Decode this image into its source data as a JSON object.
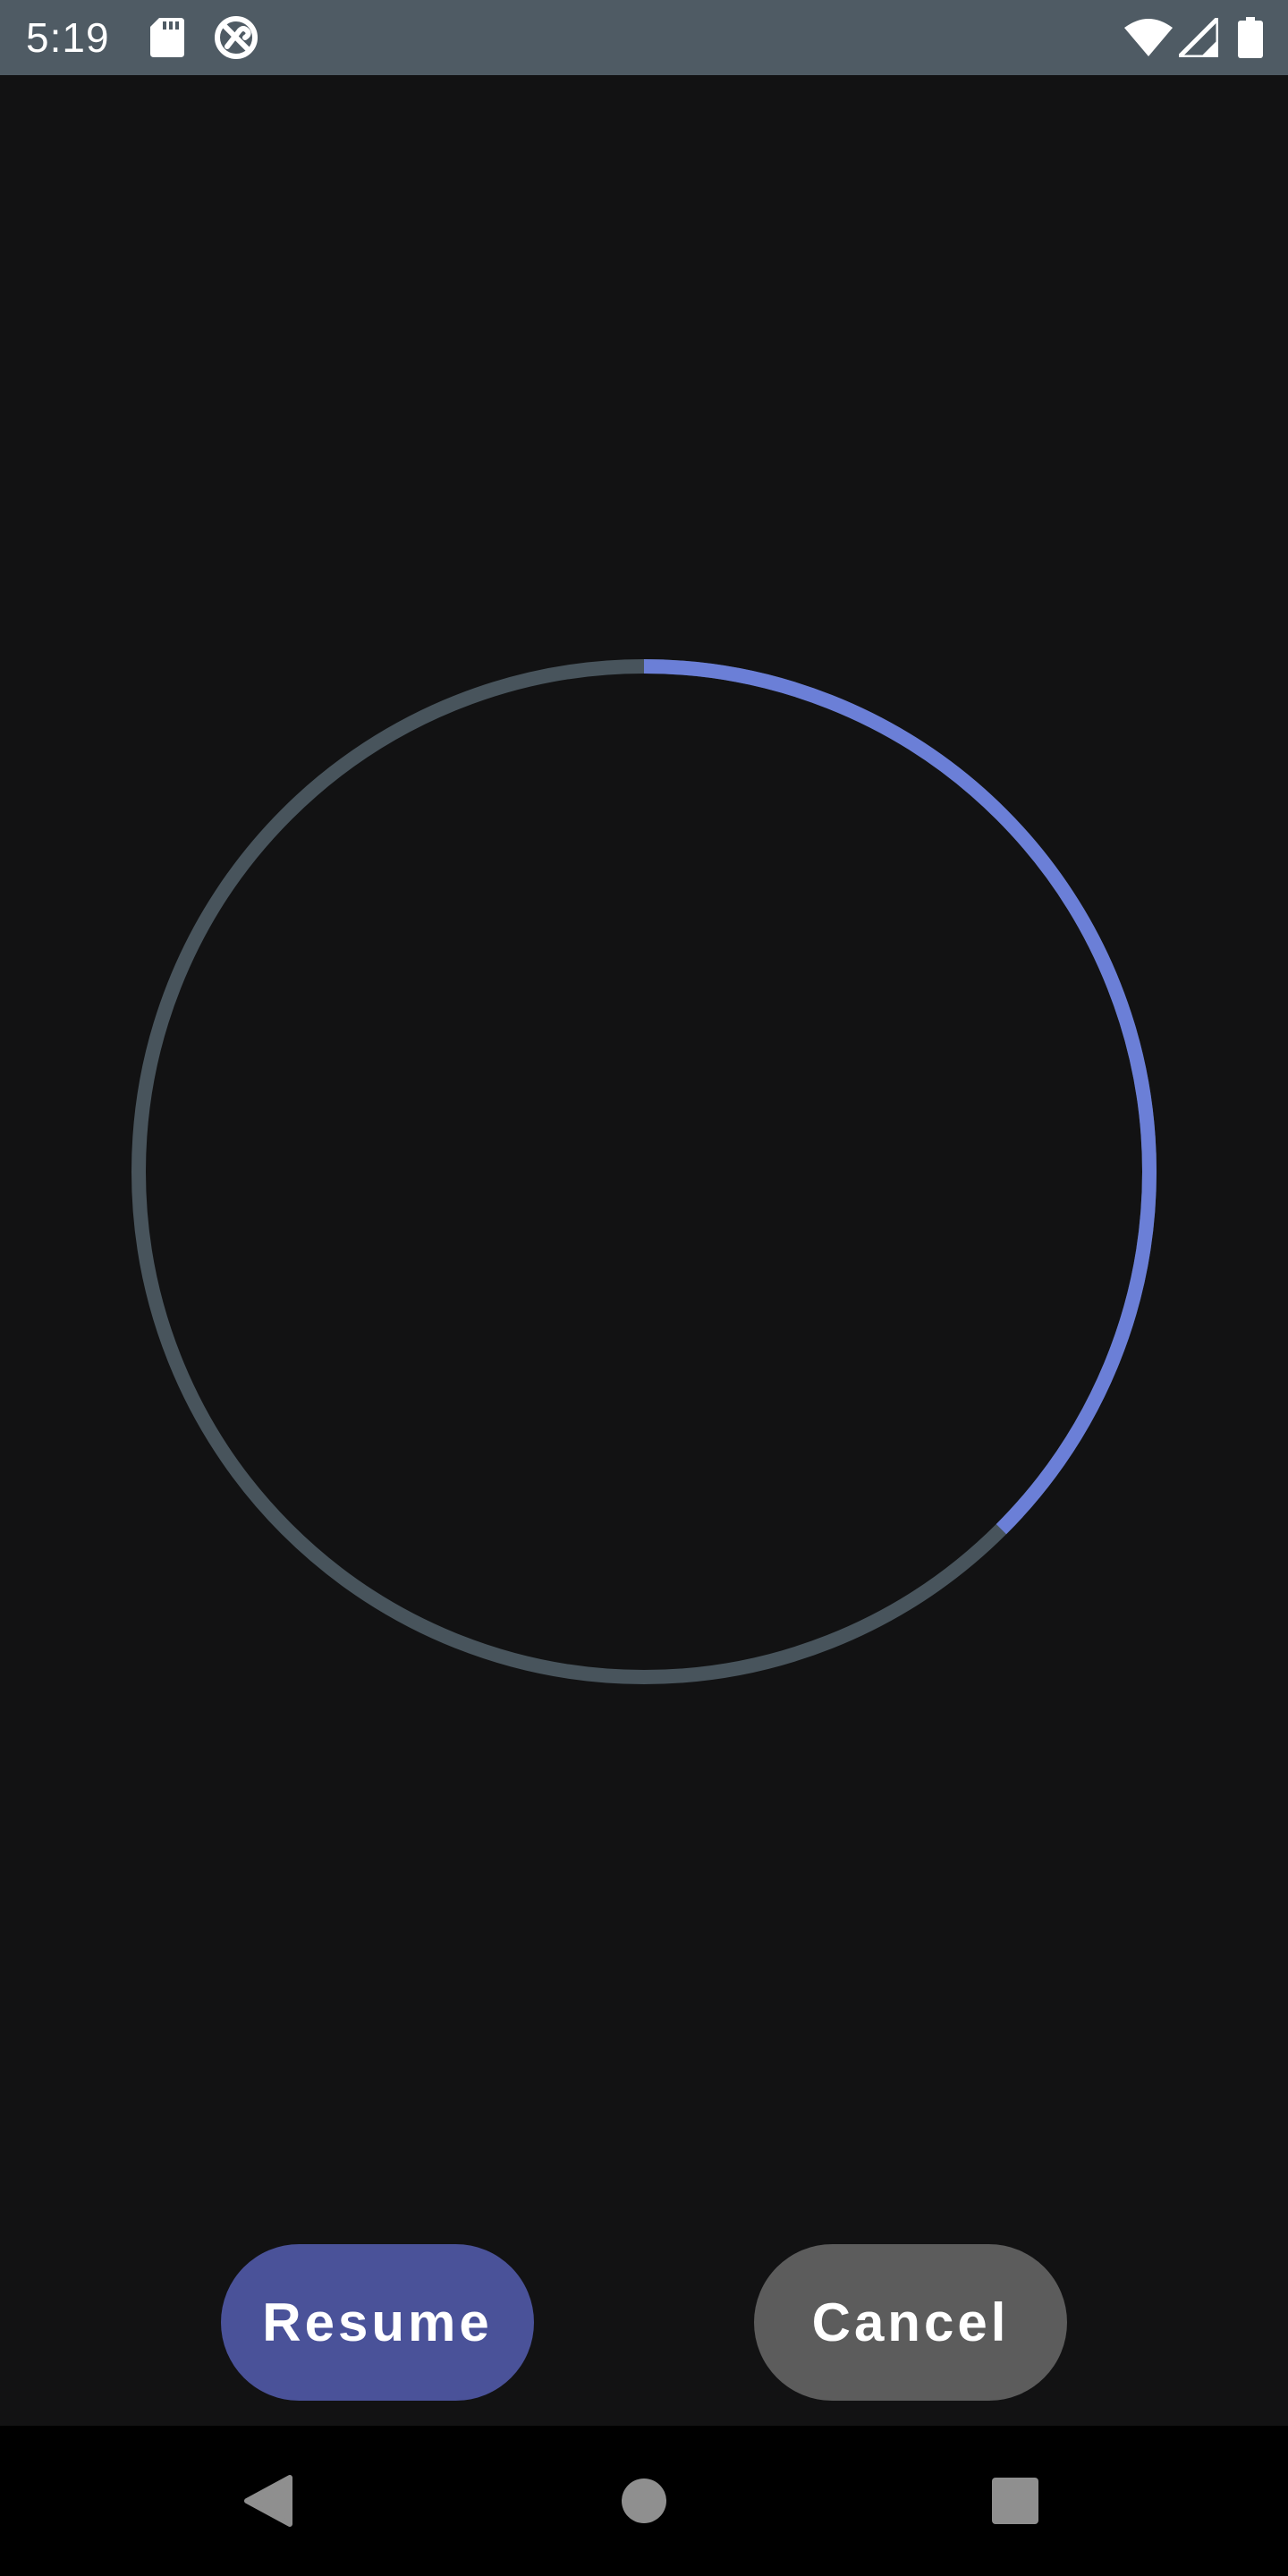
{
  "status_bar": {
    "time": "5:19",
    "icons": [
      "sd-card-icon",
      "do-not-disturb-icon",
      "wifi-icon",
      "cellular-signal-icon",
      "battery-icon"
    ],
    "background": "#4f5b64"
  },
  "timer": {
    "progress": 0.375,
    "progress_color": "#6b7fd7",
    "track_color": "#48545c"
  },
  "buttons": {
    "resume_label": "Resume",
    "cancel_label": "Cancel",
    "resume_color": "#4a5299",
    "cancel_color": "#5c5c5c"
  },
  "nav_bar": {
    "icons": [
      "back-icon",
      "home-icon",
      "recents-icon"
    ]
  },
  "colors": {
    "background": "#121213"
  }
}
